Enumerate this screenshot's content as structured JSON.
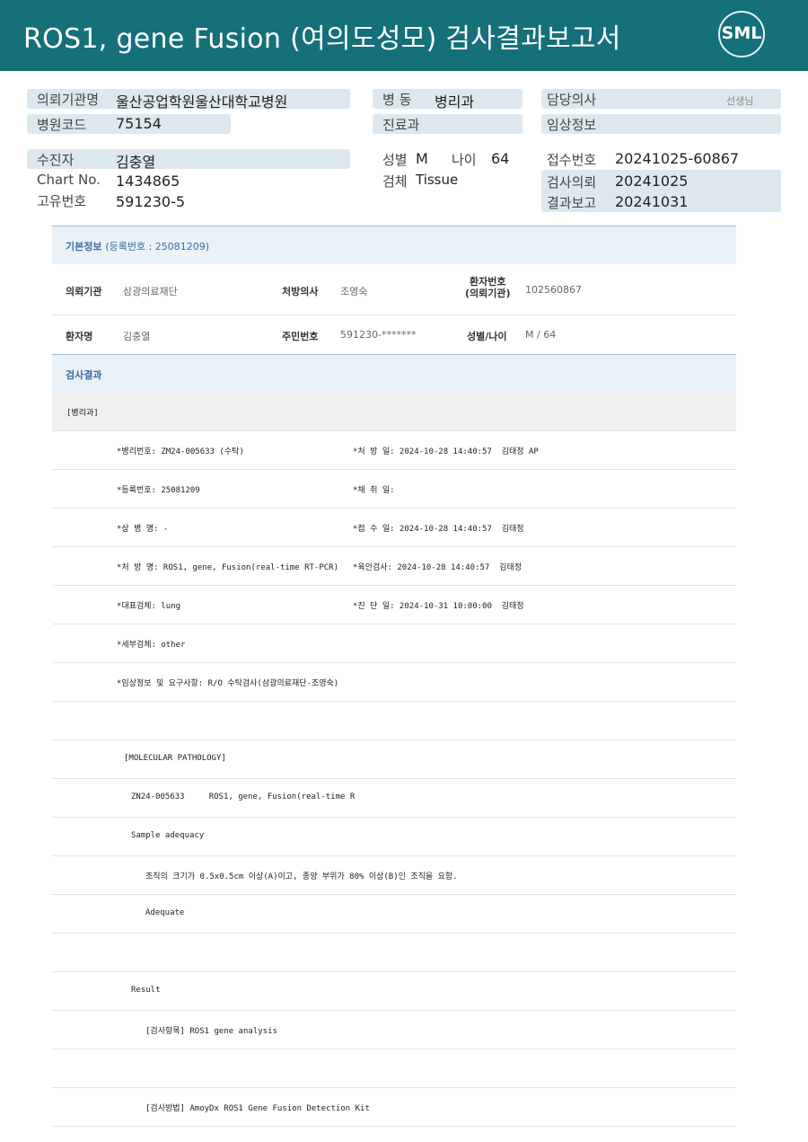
{
  "header": {
    "title": "ROS1, gene Fusion (여의도성모) 검사결과보고서",
    "logo": "SML",
    "bg_color": "#15707a"
  },
  "summary": {
    "req_inst_label": "의뢰기관명",
    "req_inst": "울산공업학원울산대학교병원",
    "ward_label": "병 동",
    "ward": "병리과",
    "doctor_label": "담당의사",
    "doctor_suffix": "선생님",
    "hosp_code_label": "병원코드",
    "hosp_code": "75154",
    "dept_label": "진료과",
    "clinical_label": "임상정보",
    "patient_label": "수진자",
    "patient": "김충열",
    "sex_label": "성별",
    "sex": "M",
    "age_label": "나이",
    "age": "64",
    "accession_label": "접수번호",
    "accession": "20241025-60867",
    "chart_label": "Chart No.",
    "chart": "1434865",
    "specimen_label": "검체",
    "specimen": "Tissue",
    "request_label": "검사의뢰",
    "request": "20241025",
    "unique_label": "고유번호",
    "unique": "591230-5",
    "report_label": "결과보고",
    "report": "20241031"
  },
  "basic": {
    "title": "기본정보",
    "reg": "(등록번호 : 25081209)",
    "inst_k": "의뢰기관",
    "inst_v": "삼광의료재단",
    "presc_k": "처방의사",
    "presc_v": "조영숙",
    "pno_k1": "환자번호",
    "pno_k2": "(의뢰기관)",
    "pno_v": "102560867",
    "name_k": "환자명",
    "name_v": "김충열",
    "rrn_k": "주민번호",
    "rrn_v": "591230-*******",
    "sexage_k": "성별/나이",
    "sexage_v": "M / 64"
  },
  "result": {
    "title": "검사결과",
    "lines": [
      {
        "a": "[병리과]",
        "b": ""
      },
      {
        "a": "*병리번호: ZM24-005633 (수탁)",
        "b": "*처 방 일: 2024-10-28 14:40:57  김태정 AP"
      },
      {
        "a": "*등록번호: 25081209",
        "b": "*채 취 일:"
      },
      {
        "a": "*상 병 명: -",
        "b": "*접 수 일: 2024-10-28 14:40:57  김태정"
      },
      {
        "a": "*처 방 명: ROS1, gene, Fusion(real-time RT-PCR)",
        "b": "*육안검사: 2024-10-28 14:40:57  김태정"
      },
      {
        "a": "*대표검체: lung",
        "b": "*진 단 일: 2024-10-31 10:00:00  김태정"
      },
      {
        "a": "*세부검체: other",
        "b": ""
      },
      {
        "a": "*임상정보 및 요구사항: R/O 수탁검사(삼광의료재단-조영숙)",
        "b": ""
      },
      {
        "a": "",
        "b": ""
      },
      {
        "a": "[MOLECULAR PATHOLOGY]",
        "b": ""
      },
      {
        "a": "ZN24-005633     ROS1, gene, Fusion(real-time R",
        "b": ""
      },
      {
        "a": "Sample adequacy",
        "b": ""
      },
      {
        "a": "조직의 크기가 0.5x0.5cm 이상(A)이고, 종양 부위가 80% 이상(B)인 조직을 요함.",
        "b": ""
      },
      {
        "a": "Adequate",
        "b": ""
      },
      {
        "a": "",
        "b": ""
      },
      {
        "a": "Result",
        "b": ""
      },
      {
        "a": "[검사항목] ROS1 gene analysis",
        "b": ""
      },
      {
        "a": "",
        "b": ""
      },
      {
        "a": "[검사방법] AmoyDx ROS1 Gene Fusion Detection Kit",
        "b": ""
      }
    ]
  }
}
